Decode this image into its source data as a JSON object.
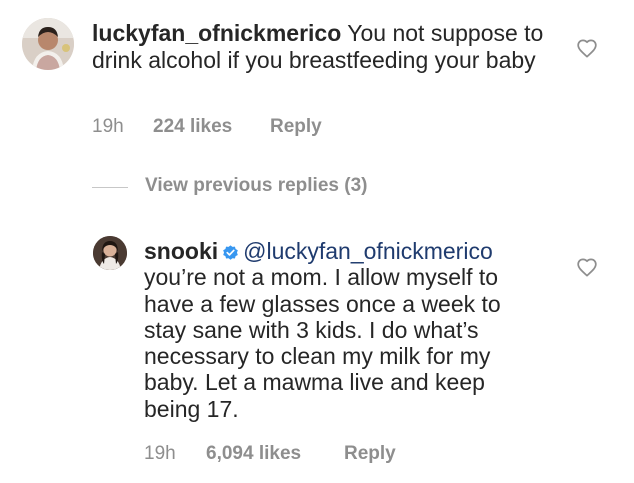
{
  "comment1": {
    "username": "luckyfan_ofnickmerico",
    "text": "You not suppose to drink alcohol if you breastfeeding your baby",
    "time": "19h",
    "likes": "224 likes",
    "reply": "Reply",
    "avatar_icon": "user-avatar",
    "heart_icon": "heart-outline-icon"
  },
  "view_replies": {
    "label": "View previous replies (3)"
  },
  "comment2": {
    "username": "snooki",
    "verified_icon": "verified-badge-icon",
    "mention": "@luckyfan_ofnickmerico",
    "text": "you’re not a mom. I allow myself to have a few glasses once a week to stay sane with 3 kids. I do what’s necessary to clean my milk for my baby. Let a mawma live and keep being 17.",
    "time": "19h",
    "likes": "6,094 likes",
    "reply": "Reply",
    "avatar_icon": "user-avatar",
    "heart_icon": "heart-outline-icon"
  },
  "colors": {
    "text": "#262626",
    "meta": "#8e8e8e",
    "verified": "#3897f0",
    "mention": "#1f3b6e"
  }
}
